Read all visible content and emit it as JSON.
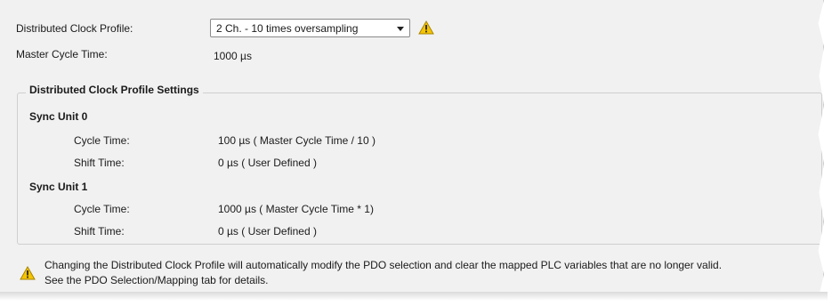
{
  "profile": {
    "label": "Distributed Clock Profile:",
    "selected": "2 Ch. - 10 times oversampling",
    "warning_icon": "warning-triangle-icon"
  },
  "master": {
    "label": "Master Cycle Time:",
    "value": "1000 µs"
  },
  "settings": {
    "title": "Distributed Clock Profile Settings",
    "sync_units": [
      {
        "title": "Sync Unit 0",
        "cycle_label": "Cycle Time:",
        "cycle_value": "100 µs ( Master Cycle Time / 10 )",
        "shift_label": "Shift Time:",
        "shift_value": "0 µs ( User Defined )"
      },
      {
        "title": "Sync Unit 1",
        "cycle_label": "Cycle Time:",
        "cycle_value": "1000 µs ( Master Cycle Time * 1)",
        "shift_label": "Shift Time:",
        "shift_value": "0 µs ( User Defined )"
      }
    ]
  },
  "notice": {
    "line1": "Changing the Distributed Clock Profile will automatically modify the PDO selection and clear the mapped PLC variables that are no longer valid.",
    "line2": "See the PDO Selection/Mapping tab for details.",
    "icon": "warning-triangle-icon"
  },
  "colors": {
    "warning": "#f5c400",
    "panel_bg": "#f1f1f1"
  }
}
